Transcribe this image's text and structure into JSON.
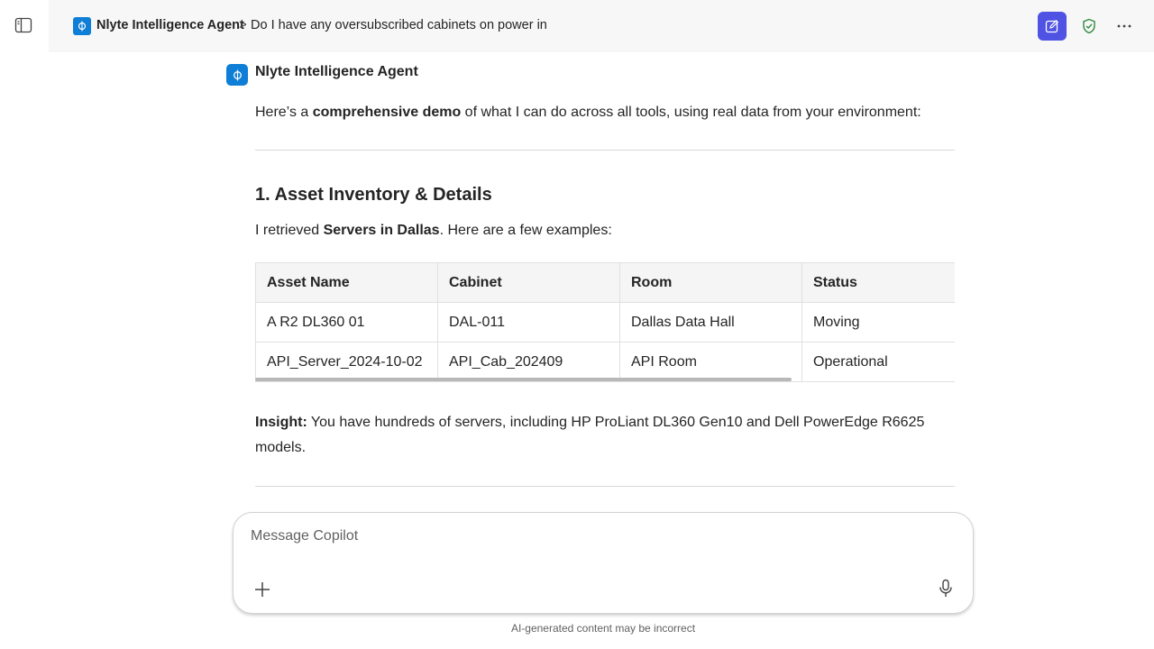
{
  "header": {
    "agent_name": "Nlyte Intelligence Agent",
    "separator": ">",
    "chat_title": "Do I have any oversubscribed cabinets on power in"
  },
  "message": {
    "author": "Nlyte Intelligence Agent",
    "intro_prefix": "Here’s a ",
    "intro_bold": "comprehensive demo",
    "intro_suffix": " of what I can do across all tools, using real data from your environment:",
    "section_title": "1. Asset Inventory & Details",
    "retrieved_prefix": "I retrieved ",
    "retrieved_bold": "Servers in Dallas",
    "retrieved_suffix": ". Here are a few examples:",
    "table": {
      "headers": [
        "Asset Name",
        "Cabinet",
        "Room",
        "Status"
      ],
      "rows": [
        [
          "A R2 DL360 01",
          "DAL-011",
          "Dallas Data Hall",
          "Moving"
        ],
        [
          "API_Server_2024-10-02",
          "API_Cab_202409",
          "API Room",
          "Operational"
        ]
      ]
    },
    "insight_label": "Insight:",
    "insight_line1": " You have hundreds of servers, including HP ProLiant DL360 Gen10 and Dell PowerEdge R6625",
    "insight_line2": "models."
  },
  "composer": {
    "placeholder": "Message Copilot",
    "value": ""
  },
  "disclaimer": "AI-generated content may be incorrect",
  "colors": {
    "accent": "#4f52e2",
    "agent_blue": "#0f7ed6",
    "shield_green": "#2e8b3e"
  },
  "icons": {
    "rail_toggle": "sidebar-toggle-icon",
    "new_chat": "compose-icon",
    "shield": "shield-check-icon",
    "more": "more-horizontal-icon",
    "add": "plus-icon",
    "mic": "microphone-icon"
  }
}
